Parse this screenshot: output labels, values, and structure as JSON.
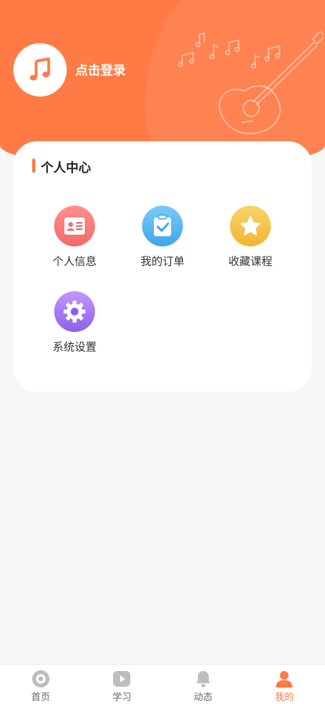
{
  "header": {
    "login_label": "点击登录",
    "avatar_icon": "music-note-icon"
  },
  "personal_center": {
    "title": "个人中心",
    "items": [
      {
        "label": "个人信息",
        "icon": "id-card-icon",
        "color": "#f97a7a"
      },
      {
        "label": "我的订单",
        "icon": "clipboard-check-icon",
        "color": "#5ab8f0"
      },
      {
        "label": "收藏课程",
        "icon": "star-icon",
        "color": "#f5c24e"
      },
      {
        "label": "系统设置",
        "icon": "gear-icon",
        "color": "#a77af5"
      }
    ]
  },
  "tabbar": {
    "items": [
      {
        "label": "首页",
        "icon": "home-disc-icon",
        "active": false
      },
      {
        "label": "学习",
        "icon": "play-icon",
        "active": false
      },
      {
        "label": "动态",
        "icon": "bell-icon",
        "active": false
      },
      {
        "label": "我的",
        "icon": "user-icon",
        "active": true
      }
    ]
  },
  "colors": {
    "accent": "#ff7a45",
    "background": "#f7f7f7"
  }
}
